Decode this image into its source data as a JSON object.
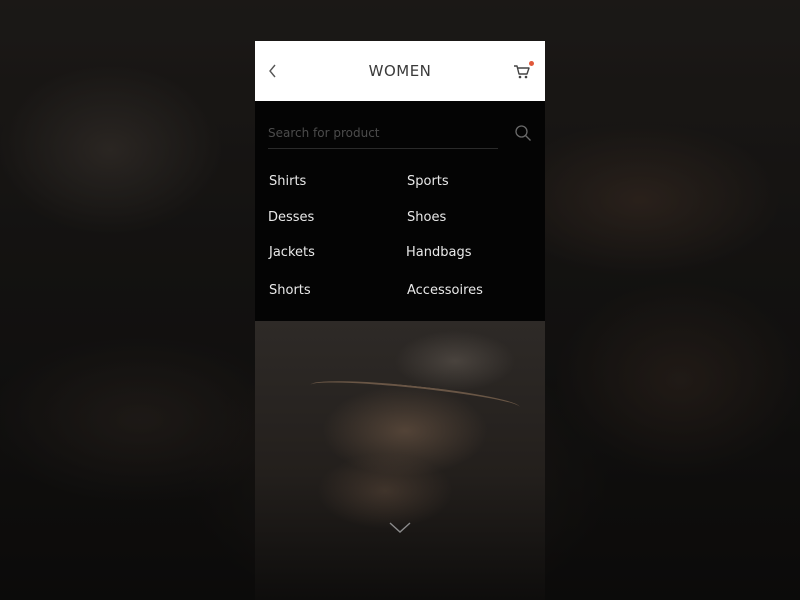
{
  "header": {
    "title": "WOMEN",
    "back_icon": "chevron-left-icon",
    "cart_icon": "shopping-cart-icon",
    "cart_badge_color": "#e0583a"
  },
  "search": {
    "placeholder": "Search for product",
    "value": "",
    "icon": "search-icon"
  },
  "categories": {
    "left": [
      "Shirts",
      "Desses",
      "Jackets",
      "Shorts"
    ],
    "right": [
      "Sports",
      "Shoes",
      "Handbags",
      "Accessoires"
    ]
  },
  "footer": {
    "scroll_icon": "chevron-down-icon"
  }
}
